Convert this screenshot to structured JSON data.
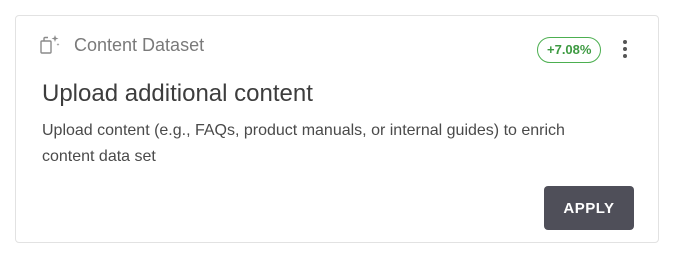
{
  "card": {
    "icon": "document-sparkle-icon",
    "category": "Content Dataset",
    "badge": "+7.08%",
    "badge_color": "#4caf50",
    "title": "Upload additional content",
    "description": "Upload content (e.g., FAQs, product manuals, or internal guides) to enrich content data set",
    "apply_label": "APPLY",
    "button_color": "#4f4f59",
    "more_icon": "more-vertical-icon"
  }
}
